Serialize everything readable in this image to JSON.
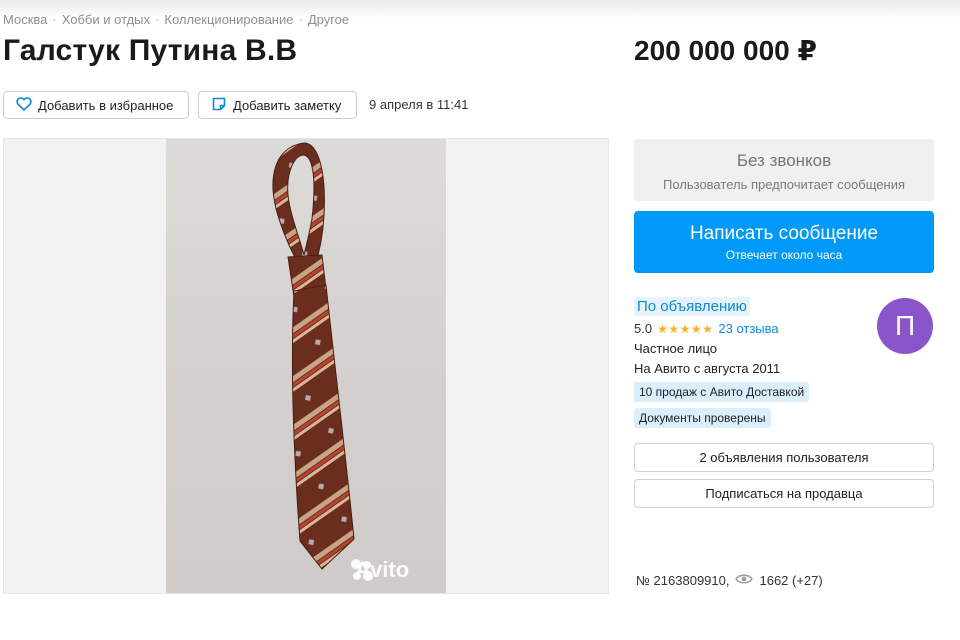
{
  "breadcrumbs": [
    "Москва",
    "Хобби и отдых",
    "Коллекционирование",
    "Другое"
  ],
  "listing": {
    "title": "Галстук Путина В.В",
    "price": "200 000 000 ₽",
    "date": "9 апреля в 11:41",
    "favorite_label": "Добавить в избранное",
    "note_label": "Добавить заметку"
  },
  "photo": {
    "watermark": "Avito"
  },
  "contact": {
    "no_calls_title": "Без звонков",
    "no_calls_sub": "Пользователь предпочитает сообщения",
    "message_label": "Написать сообщение",
    "message_sub": "Отвечает около часа"
  },
  "seller": {
    "name": "По объявлению",
    "rating_value": "5.0",
    "stars": "★★★★★",
    "reviews": "23 отзыва",
    "type": "Частное лицо",
    "since": "На Авито с августа 2011",
    "tags": [
      "10 продаж с Авито Доставкой",
      "Документы проверены"
    ],
    "avatar_letter": "П",
    "avatar_color": "#8a55c9"
  },
  "actions": {
    "user_ads": "2 объявления пользователя",
    "subscribe": "Подписаться на продавца"
  },
  "footer": {
    "item_number": "№ 2163809910,",
    "views": "1662 (+27)"
  },
  "colors": {
    "accent": "#0099f7",
    "link": "#0a8ad6",
    "star": "#ffb021"
  }
}
